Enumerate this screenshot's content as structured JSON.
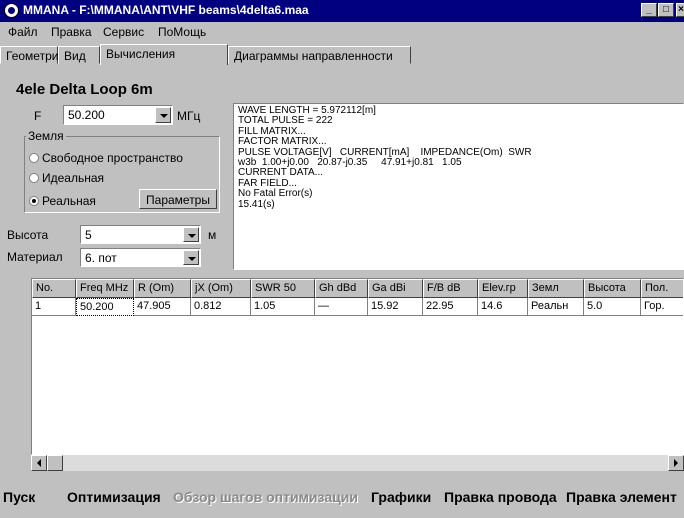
{
  "window": {
    "title": "MMANA - F:\\MMANA\\ANT\\VHF beams\\4delta6.maa",
    "controls": [
      "_",
      "□",
      "×"
    ]
  },
  "menu": [
    {
      "label": "Файл"
    },
    {
      "label": "Правка"
    },
    {
      "label": "Сервис"
    },
    {
      "label": "ПоМощь"
    }
  ],
  "tabs": [
    {
      "label": "Геометрия",
      "active": false
    },
    {
      "label": "Вид",
      "active": false
    },
    {
      "label": "Вычисления",
      "active": true
    },
    {
      "label": "Диаграммы направленности",
      "active": false
    }
  ],
  "antenna_name": "4ele Delta Loop 6m",
  "frequency": {
    "label": "F",
    "value": "50.200",
    "unit": "МГц"
  },
  "ground": {
    "label": "Земля",
    "options": [
      {
        "label": "Свободное пространство",
        "selected": false
      },
      {
        "label": "Идеальная",
        "selected": false
      },
      {
        "label": "Реальная",
        "selected": true
      }
    ],
    "params_button": "Параметры"
  },
  "height": {
    "label": "Высота",
    "value": "5",
    "unit": "м"
  },
  "material": {
    "label": "Материал",
    "value": "6. пот"
  },
  "output_log": "WAVE LENGTH = 5.972112[m]\nTOTAL PULSE = 222\nFILL MATRIX...\nFACTOR MATRIX...\nPULSE VOLTAGE[V]   CURRENT[mA]    IMPEDANCE(Om)  SWR\nw3b  1.00+j0.00   20.87-j0.35     47.91+j0.81   1.05\nCURRENT DATA...\nFAR FIELD...\nNo Fatal Error(s)\n15.41(s)",
  "table": {
    "headers": [
      "No.",
      "Freq MHz",
      "R (Om)",
      "jX (Om)",
      "SWR 50",
      "Gh dBd",
      "Ga dBi",
      "F/B dB",
      "Elev.гр",
      "Земл",
      "Высота",
      "Пол."
    ],
    "rows": [
      [
        "1",
        "50.200",
        "47.905",
        "0.812",
        "1.05",
        "—",
        "15.92",
        "22.95",
        "14.6",
        "Реальн",
        "5.0",
        "Гор."
      ]
    ]
  },
  "buttons": [
    {
      "label": "Пуск",
      "enabled": true
    },
    {
      "label": "Оптимизация",
      "enabled": true
    },
    {
      "label": "Обзор шагов оптимизации",
      "enabled": false
    },
    {
      "label": "Графики",
      "enabled": true
    },
    {
      "label": "Правка провода",
      "enabled": true
    },
    {
      "label": "Правка элемент",
      "enabled": true
    }
  ]
}
